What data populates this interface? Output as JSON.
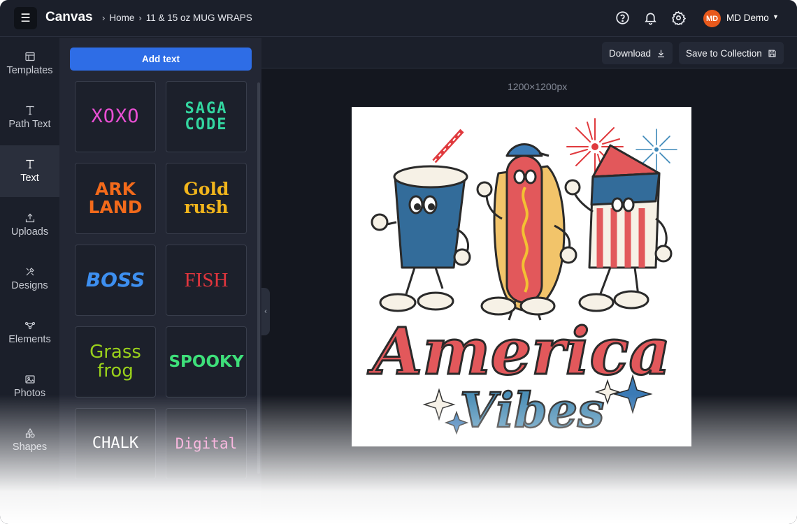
{
  "header": {
    "app_title": "Canvas",
    "breadcrumb": [
      "Home",
      "11 & 15 oz MUG WRAPS"
    ],
    "user": {
      "initials": "MD",
      "name": "MD Demo"
    },
    "icons": [
      "help-icon",
      "bell-icon",
      "gear-icon"
    ]
  },
  "leftnav": {
    "items": [
      {
        "label": "Templates",
        "icon": "template-icon"
      },
      {
        "label": "Path Text",
        "icon": "text-icon"
      },
      {
        "label": "Text",
        "icon": "text-icon",
        "active": true
      },
      {
        "label": "Uploads",
        "icon": "upload-icon"
      },
      {
        "label": "Designs",
        "icon": "designs-icon"
      },
      {
        "label": "Elements",
        "icon": "elements-icon"
      },
      {
        "label": "Photos",
        "icon": "photo-icon"
      },
      {
        "label": "Shapes",
        "icon": "shapes-icon"
      }
    ]
  },
  "panel": {
    "add_text_label": "Add text",
    "styles": [
      {
        "text": "XOXO",
        "color": "#e94fd4"
      },
      {
        "text": "SAGA\nCODE",
        "color": "#33d6a0"
      },
      {
        "text": "ARK\nLAND",
        "color": "#f26a1b"
      },
      {
        "text": "Gold\nrush",
        "color": "#f1b51c"
      },
      {
        "text": "BOSS",
        "color": "#3d8ff0"
      },
      {
        "text": "FISH",
        "color": "#e0353d"
      },
      {
        "text": "Grass\nfrog",
        "color": "#9ad11b"
      },
      {
        "text": "SPOOKY",
        "color": "#3ee07a"
      },
      {
        "text": "CHALK",
        "color": "#ffffff"
      },
      {
        "text": "Digital",
        "color": "#f47bc4"
      }
    ]
  },
  "toolbar": {
    "download_label": "Download",
    "save_label": "Save to Collection"
  },
  "canvas": {
    "size_label": "1200×1200px",
    "design_text_1": "America",
    "design_text_2": "Vibes"
  }
}
